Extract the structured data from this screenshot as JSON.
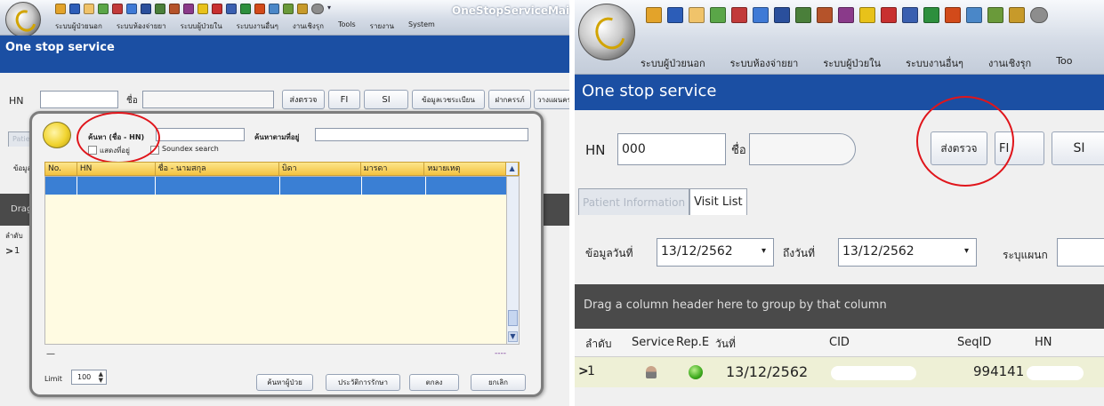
{
  "left": {
    "form_title": "OneStopServiceMainForm",
    "menu": [
      "ระบบผู้ป่วยนอก",
      "ระบบห้องจ่ายยา",
      "ระบบผู้ป่วยใน",
      "ระบบงานอื่นๆ",
      "งานเชิงรุก",
      "Tools",
      "รายงาน",
      "System"
    ],
    "header_title": "One stop service",
    "hn_label": "HN",
    "name_label": "ชื่อ",
    "buttons": [
      "ส่งตรวจ",
      "FI",
      "SI",
      "ข้อมูลเวชระเบียน",
      "ฝากครรภ์",
      "วางแผนคร"
    ],
    "tab_patient": "Patien",
    "data_label": "ข้อมูล",
    "drag_text": "Drag",
    "order_label": "ลำดับ",
    "row_indicator": ">",
    "row_no": "1",
    "dialog": {
      "search_label": "ค้นหา (ชื่อ - HN)",
      "address_search_label": "ค้นหาตามที่อยู่",
      "show_address_label": "แสดงที่อยู่",
      "soundex_label": "Soundex search",
      "columns": [
        "No.",
        "HN",
        "ชื่อ - นามสกุล",
        "บิดา",
        "มารดา",
        "หมายเหตุ"
      ],
      "dash_left": "—",
      "dash_right": "----",
      "limit_label": "Limit",
      "limit_value": "100",
      "buttons": [
        "ค้นหาผู้ป่วย",
        "ประวัติการรักษา",
        "ตกลง",
        "ยกเลิก"
      ]
    }
  },
  "right": {
    "menu": [
      "ระบบผู้ป่วยนอก",
      "ระบบห้องจ่ายยา",
      "ระบบผู้ป่วยใน",
      "ระบบงานอื่นๆ",
      "งานเชิงรุก",
      "Too"
    ],
    "header_title": "One stop service",
    "hn_label": "HN",
    "hn_value": "000",
    "name_label": "ชื่อ",
    "buttons": [
      "ส่งตรวจ",
      "FI",
      "SI"
    ],
    "tabs": [
      "Patient Information",
      "Visit List"
    ],
    "from_date_label": "ข้อมูลวันที่",
    "from_date_value": "13/12/2562",
    "to_date_label": "ถึงวันที่",
    "to_date_value": "13/12/2562",
    "dept_label": "ระบุแผนก",
    "drag_text": "Drag a column header here to group by that column",
    "columns": [
      "ลำดับ",
      "Service",
      "Rep.E",
      "วันที่",
      "CID",
      "SeqID",
      "HN"
    ],
    "row": {
      "indicator": ">",
      "no": "1",
      "date": "13/12/2562",
      "seqid": "994141"
    }
  },
  "colors": {
    "header_blue": "#1b4fa3",
    "highlight_red": "#e0151b",
    "grid_header_yellow": "#f3c240",
    "selected_row_blue": "#3a7fd4",
    "dark_group_bar": "#4a4a4a"
  },
  "icons": {
    "app_logo": "app-logo-icon",
    "quick_access": "quick-access-toolbar-icons",
    "user": "user-icon",
    "status_ok": "green-face-status-icon",
    "search_magnifier": "search-magnifier-icon"
  }
}
